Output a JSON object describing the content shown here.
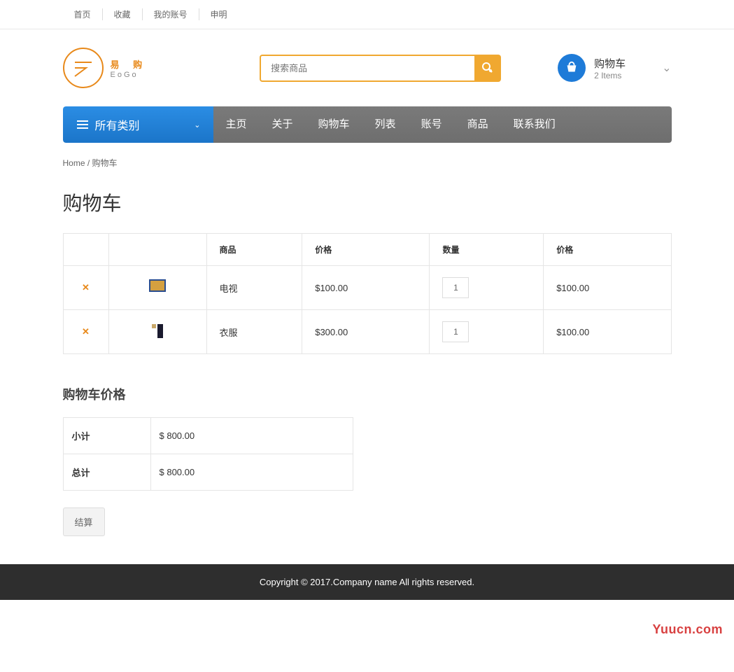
{
  "top_nav": {
    "home": "首页",
    "favorite": "收藏",
    "account": "我的账号",
    "shenming": "申明"
  },
  "logo": {
    "cn": "易 购",
    "en": "EoGo"
  },
  "search": {
    "placeholder": "搜索商品"
  },
  "cart_widget": {
    "title": "购物车",
    "count": "2 Items"
  },
  "category_dropdown": "所有类别",
  "nav": {
    "home": "主页",
    "about": "关于",
    "cart": "购物车",
    "list": "列表",
    "account": "账号",
    "product": "商品",
    "contact": "联系我们"
  },
  "breadcrumb": {
    "home": "Home",
    "sep": " / ",
    "current": "购物车"
  },
  "page_title": "购物车",
  "table": {
    "headers": {
      "product": "商品",
      "price": "价格",
      "qty": "数量",
      "total": "价格"
    },
    "rows": [
      {
        "name": "电视",
        "price": "$100.00",
        "qty": "1",
        "total": "$100.00"
      },
      {
        "name": "衣服",
        "price": "$300.00",
        "qty": "1",
        "total": "$100.00"
      }
    ]
  },
  "totals": {
    "title": "购物车价格",
    "subtotal_label": "小计",
    "subtotal_value": "$ 800.00",
    "total_label": "总计",
    "total_value": "$ 800.00"
  },
  "checkout": "结算",
  "footer": "Copyright © 2017.Company name All rights reserved.",
  "watermark": "Yuucn.com"
}
